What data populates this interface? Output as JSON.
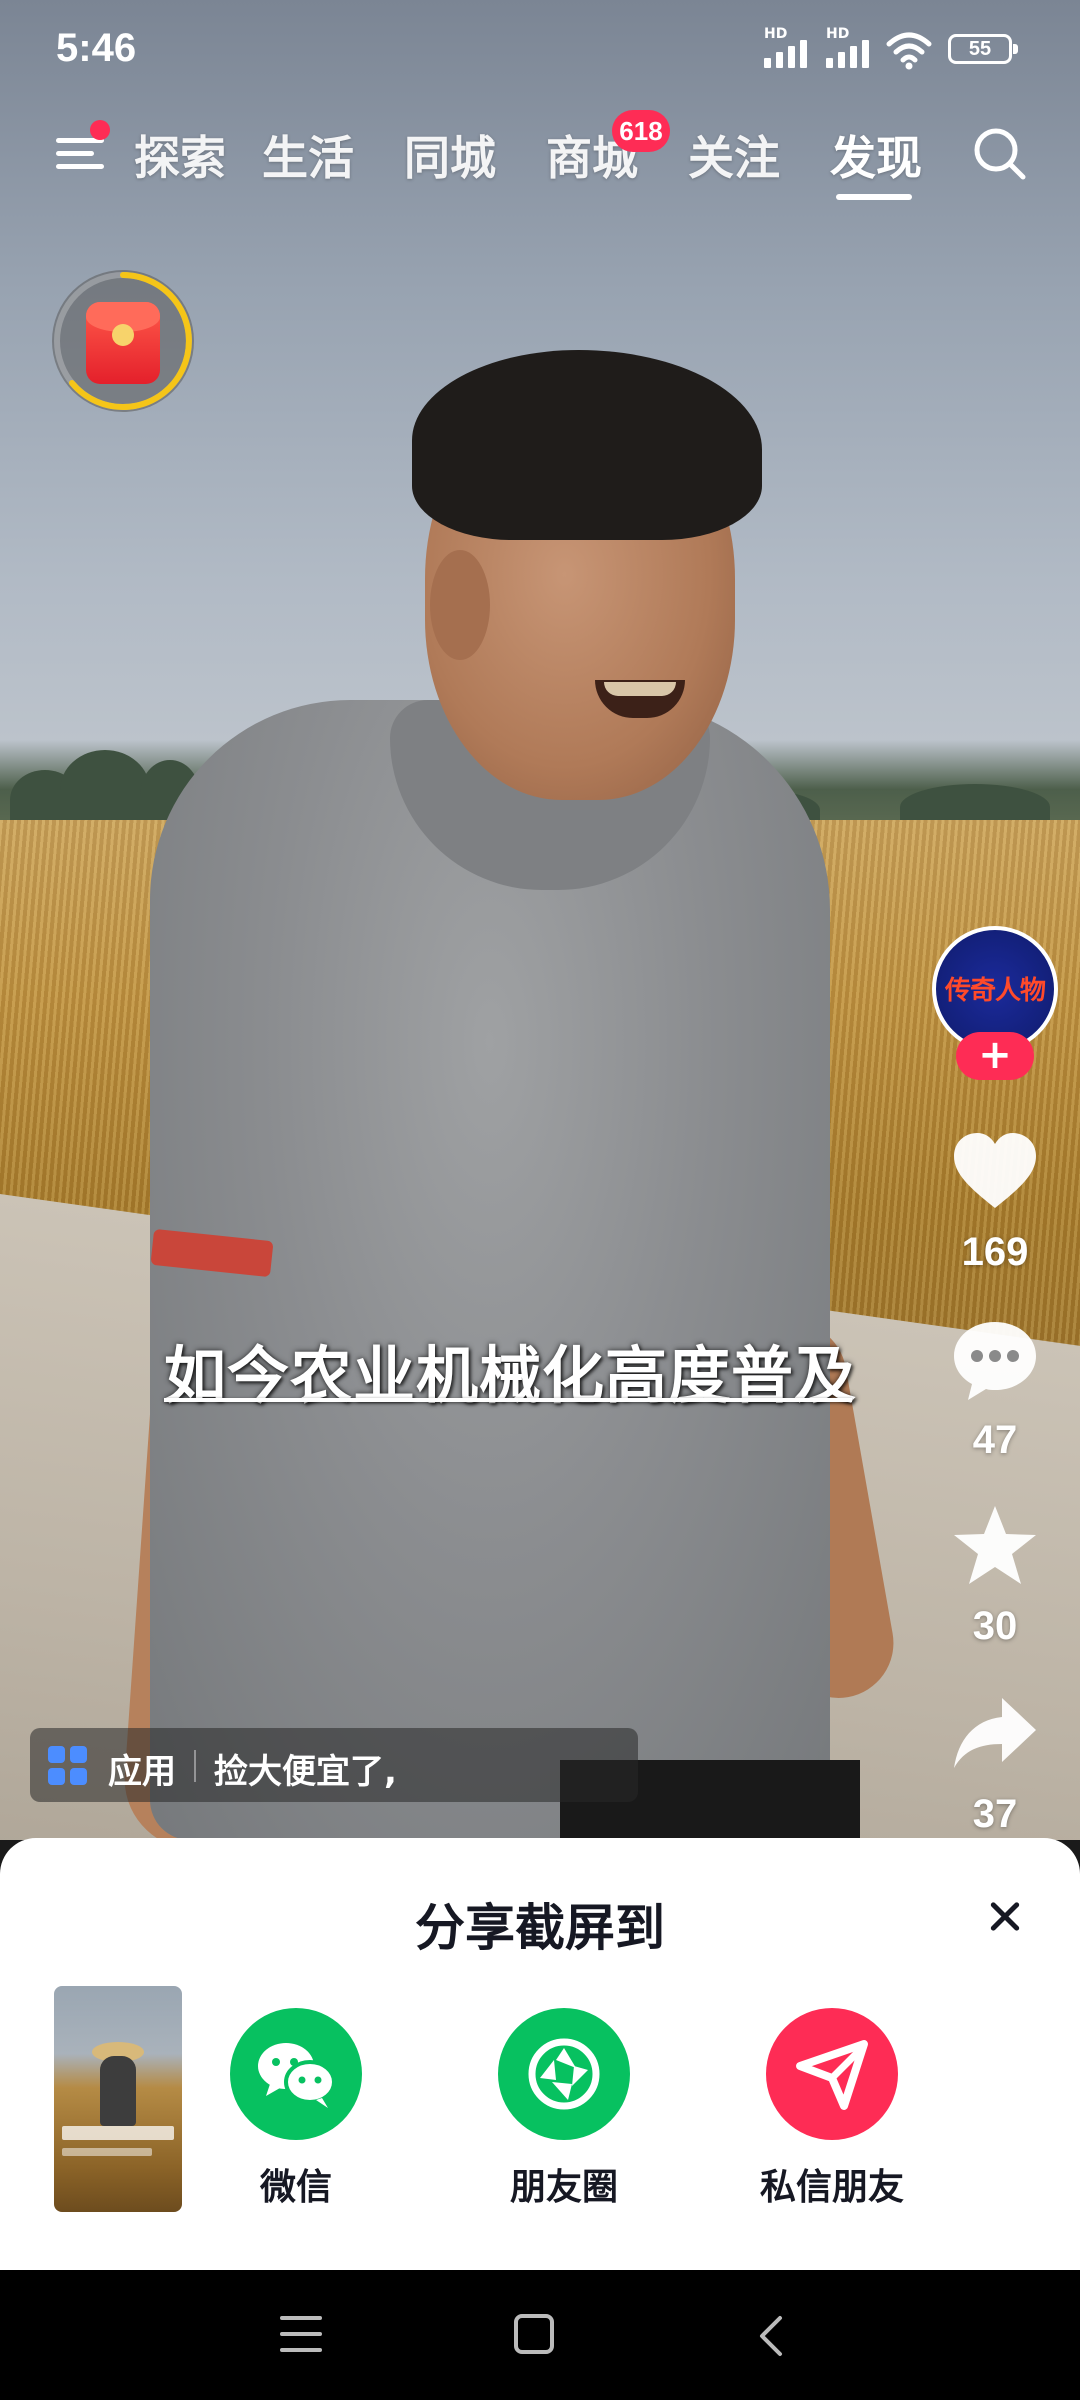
{
  "status_bar": {
    "time": "5:46",
    "sim1_label": "HD",
    "sim2_label": "HD",
    "battery": "55"
  },
  "nav": {
    "tabs": [
      {
        "label": "探索",
        "active": false
      },
      {
        "label": "生活",
        "active": false
      },
      {
        "label": "同城",
        "active": false
      },
      {
        "label": "商城",
        "active": false,
        "badge": "618"
      },
      {
        "label": "关注",
        "active": false
      },
      {
        "label": "发现",
        "active": true
      }
    ],
    "menu_icon": "hamburger-menu-icon",
    "search_icon": "search-icon"
  },
  "video": {
    "subtitle": "如今农业机械化高度普及",
    "author_avatar_text": "传奇人物",
    "like_count": "169",
    "comment_count": "47",
    "favorite_count": "30",
    "share_count": "37",
    "app_tag": {
      "label": "应用",
      "text": "捡大便宜了,"
    }
  },
  "share_sheet": {
    "title": "分享截屏到",
    "targets": [
      {
        "label": "微信",
        "icon": "wechat-icon",
        "color": "#07c160"
      },
      {
        "label": "朋友圈",
        "icon": "moments-icon",
        "color": "#07c160"
      },
      {
        "label": "私信朋友",
        "icon": "send-message-icon",
        "color": "#fe2c55"
      }
    ]
  },
  "colors": {
    "accent": "#fe2c55",
    "wechat_green": "#07c160",
    "sheet_bg": "#ffffff",
    "text_dark": "#161823"
  }
}
